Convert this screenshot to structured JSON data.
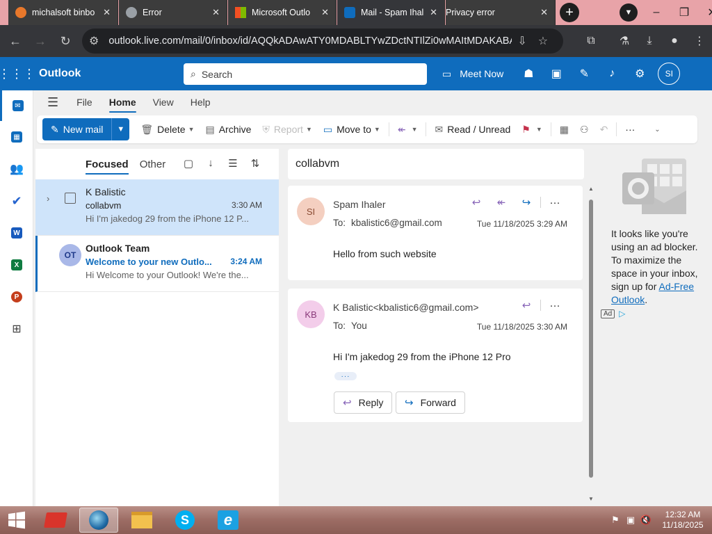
{
  "browser": {
    "tabs": [
      {
        "title": "michalsoft binbo",
        "color": "#e8782b"
      },
      {
        "title": "Error",
        "color": "#9aa0a6"
      },
      {
        "title": "Microsoft Outlo",
        "color": "#f25022"
      },
      {
        "title": "Mail - Spam Ihal",
        "color": "#0f6cbd"
      },
      {
        "title": "Privacy error",
        "color": ""
      }
    ],
    "url": "outlook.live.com/mail/0/inbox/id/AQQkADAwATY0MDABLTYwZDctNTIlZi0wMAItMDAKABAA..."
  },
  "outlook": {
    "brand": "Outlook",
    "search_placeholder": "Search",
    "meet_now": "Meet Now",
    "user_initials": "SI"
  },
  "menu": {
    "tabs": [
      "File",
      "Home",
      "View",
      "Help"
    ],
    "active": "Home"
  },
  "ribbon": {
    "new_mail": "New mail",
    "delete": "Delete",
    "archive": "Archive",
    "report": "Report",
    "move_to": "Move to",
    "read_unread": "Read / Unread"
  },
  "list": {
    "focused": "Focused",
    "other": "Other",
    "messages": [
      {
        "sender": "K Balistic",
        "subject": "collabvm",
        "time": "3:30 AM",
        "preview": "Hi I'm jakedog 29 from the iPhone 12 P...",
        "selected": true,
        "unread": false
      },
      {
        "sender": "Outlook Team",
        "initials": "OT",
        "subject": "Welcome to your new Outlo...",
        "time": "3:24 AM",
        "preview": "Hi Welcome to your Outlook! We're the...",
        "selected": false,
        "unread": true
      }
    ]
  },
  "reading": {
    "subject": "collabvm",
    "messages": [
      {
        "initials": "SI",
        "avatar_bg": "#f4cfc0",
        "avatar_fg": "#8a4b32",
        "from": "Spam Ihaler",
        "to_label": "To:",
        "to": "kbalistic6@gmail.com",
        "date": "Tue 11/18/2025 3:29 AM",
        "body": "Hello from such website"
      },
      {
        "initials": "KB",
        "avatar_bg": "#f3cdea",
        "avatar_fg": "#8a3a7a",
        "from": "K Balistic<kbalistic6@gmail.com>",
        "to_label": "To:",
        "to": "You",
        "date": "Tue 11/18/2025 3:30 AM",
        "body": "Hi I'm jakedog 29 from the iPhone 12 Pro",
        "ellipsis": "···",
        "reply": "Reply",
        "forward": "Forward"
      }
    ]
  },
  "ad": {
    "text_before": "It looks like you're using an ad blocker. To maximize the space in your inbox, sign up for ",
    "link": "Ad-Free Outlook",
    "text_after": ".",
    "badge": "Ad"
  },
  "taskbar": {
    "time": "12:32 AM",
    "date": "11/18/2025"
  },
  "colors": {
    "accent": "#0f6cbd",
    "selected_row": "#cfe4fa"
  }
}
